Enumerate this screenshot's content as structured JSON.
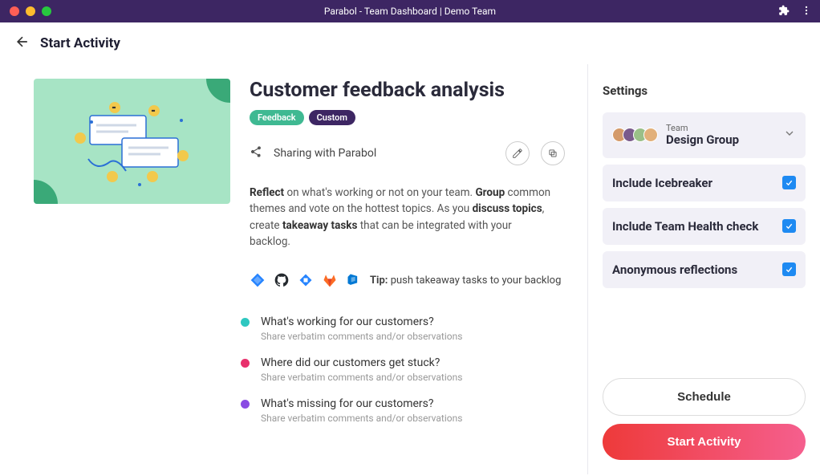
{
  "titlebar": {
    "title": "Parabol - Team Dashboard | Demo Team"
  },
  "header": {
    "title": "Start Activity"
  },
  "activity": {
    "title": "Customer feedback analysis",
    "badges": {
      "feedback": "Feedback",
      "custom": "Custom"
    },
    "sharing_text": "Sharing with Parabol",
    "description": {
      "reflect_label": "Reflect",
      "reflect_text": " on what's working or not on your team. ",
      "group_label": "Group",
      "group_text": " common themes and vote on the hottest topics. As you ",
      "discuss_label": "discuss topics",
      "discuss_text": ", create ",
      "takeaway_label": "takeaway tasks",
      "takeaway_text": " that can be integrated with your backlog."
    },
    "tip": {
      "label": "Tip:",
      "text": " push takeaway tasks to your backlog"
    }
  },
  "integrations": {
    "items": [
      {
        "name": "jira-icon",
        "color": "#2684ff"
      },
      {
        "name": "github-icon",
        "color": "#24292e"
      },
      {
        "name": "azure-icon",
        "color": "#2684ff"
      },
      {
        "name": "gitlab-icon",
        "color": "#fc6d26"
      },
      {
        "name": "azure-devops-icon",
        "color": "#0078d4"
      }
    ]
  },
  "prompts": [
    {
      "color": "#2ec7c0",
      "question": "What's working for our customers?",
      "sub": "Share verbatim comments and/or observations"
    },
    {
      "color": "#e8306c",
      "question": "Where did our customers get stuck?",
      "sub": "Share verbatim comments and/or observations"
    },
    {
      "color": "#8a4be3",
      "question": "What's missing for our customers?",
      "sub": "Share verbatim comments and/or observations"
    }
  ],
  "settings": {
    "title": "Settings",
    "team": {
      "label": "Team",
      "name": "Design Group"
    },
    "toggles": {
      "icebreaker": "Include Icebreaker",
      "health": "Include Team Health check",
      "anon": "Anonymous reflections"
    }
  },
  "buttons": {
    "schedule": "Schedule",
    "start": "Start Activity"
  },
  "avatar_colors": [
    "#d49a6a",
    "#7a5a8c",
    "#9abf88",
    "#e2b07a"
  ]
}
